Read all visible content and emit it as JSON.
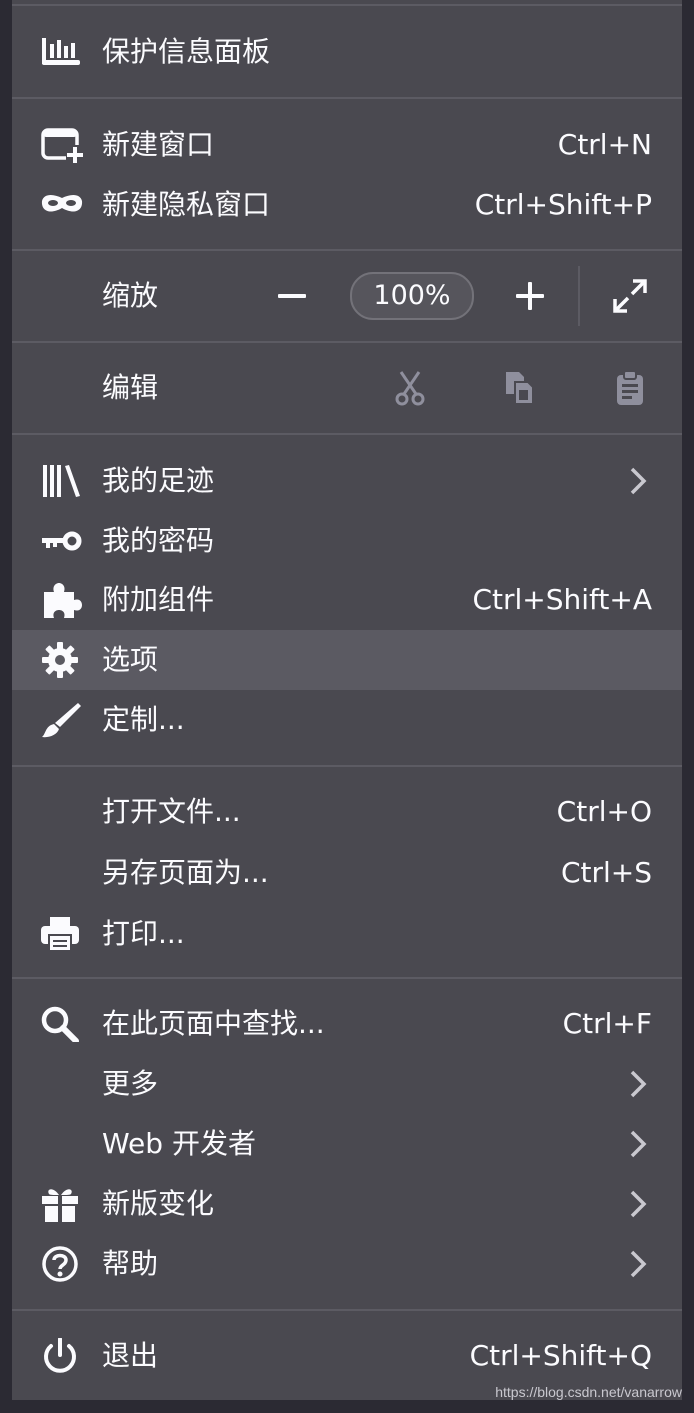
{
  "menu": {
    "dashboard": {
      "label": "保护信息面板",
      "icon": "chart-icon"
    },
    "new_window": {
      "label": "新建窗口",
      "shortcut": "Ctrl+N",
      "icon": "new-window-icon"
    },
    "new_private": {
      "label": "新建隐私窗口",
      "shortcut": "Ctrl+Shift+P",
      "icon": "private-mask-icon"
    },
    "zoom": {
      "label": "缩放",
      "value": "100%"
    },
    "edit": {
      "label": "编辑"
    },
    "library": {
      "label": "我的足迹",
      "icon": "library-icon"
    },
    "passwords": {
      "label": "我的密码",
      "icon": "key-icon"
    },
    "addons": {
      "label": "附加组件",
      "shortcut": "Ctrl+Shift+A",
      "icon": "puzzle-icon"
    },
    "options": {
      "label": "选项",
      "icon": "gear-icon"
    },
    "customize": {
      "label": "定制...",
      "icon": "brush-icon"
    },
    "open_file": {
      "label": "打开文件...",
      "shortcut": "Ctrl+O"
    },
    "save_as": {
      "label": "另存页面为...",
      "shortcut": "Ctrl+S"
    },
    "print": {
      "label": "打印...",
      "icon": "printer-icon"
    },
    "find": {
      "label": "在此页面中查找...",
      "shortcut": "Ctrl+F",
      "icon": "search-icon"
    },
    "more": {
      "label": "更多"
    },
    "web_dev": {
      "label": "Web 开发者"
    },
    "whats_new": {
      "label": "新版变化",
      "icon": "gift-icon"
    },
    "help": {
      "label": "帮助",
      "icon": "help-icon"
    },
    "quit": {
      "label": "退出",
      "shortcut": "Ctrl+Shift+Q",
      "icon": "power-icon"
    }
  },
  "watermark": "https://blog.csdn.net/vanarrow",
  "colors": {
    "menu_bg": "#4a4950",
    "highlight": "#5b5a62",
    "separator": "#5c5b63",
    "text": "#fbfbfe",
    "disabled": "#8f8f9d"
  }
}
